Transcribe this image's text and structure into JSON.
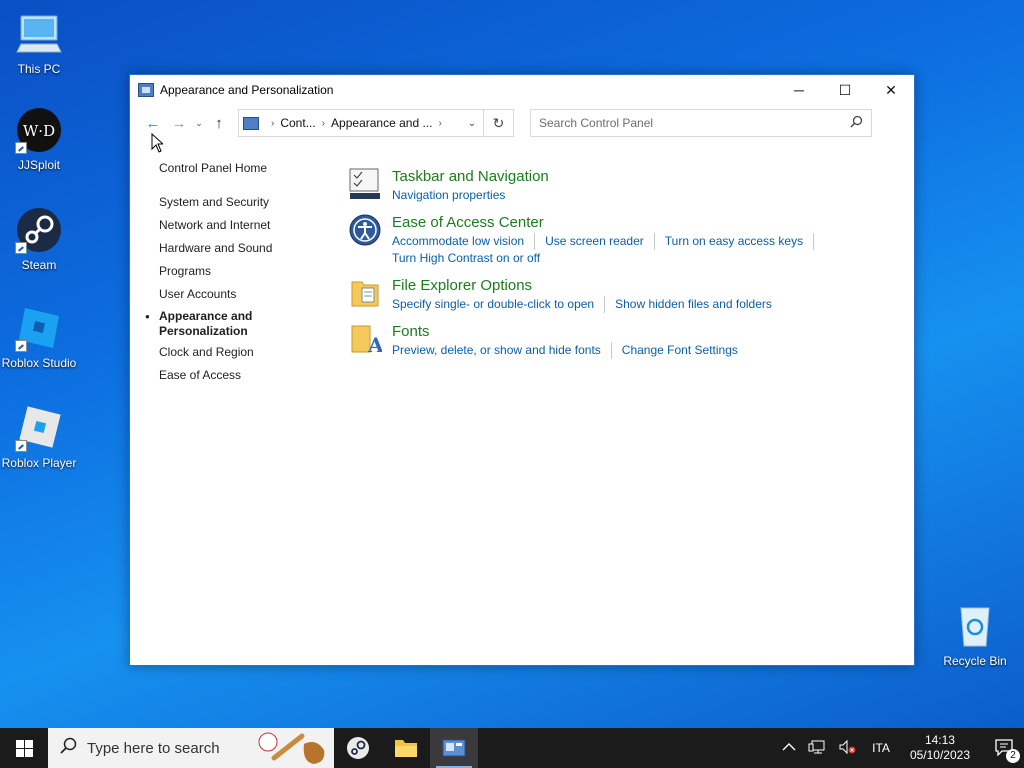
{
  "desktop": {
    "icons": [
      {
        "label": "This PC"
      },
      {
        "label": "JJSploit"
      },
      {
        "label": "Steam"
      },
      {
        "label": "Roblox Studio"
      },
      {
        "label": "Roblox Player"
      },
      {
        "label": "Recycle Bin"
      }
    ]
  },
  "window": {
    "title": "Appearance and Personalization",
    "controls": {
      "minimize": "─",
      "maximize": "☐",
      "close": "✕"
    },
    "nav": {
      "back": "←",
      "forward": "→",
      "recent": "⌄",
      "up": "↑"
    },
    "address": {
      "crumbs": [
        "Cont...",
        "Appearance and ..."
      ],
      "refresh": "↻"
    },
    "search": {
      "placeholder": "Search Control Panel"
    },
    "sidebar": {
      "home": "Control Panel Home",
      "items": [
        "System and Security",
        "Network and Internet",
        "Hardware and Sound",
        "Programs",
        "User Accounts",
        "Appearance and Personalization",
        "Clock and Region",
        "Ease of Access"
      ],
      "active_index": 5
    },
    "categories": [
      {
        "title": "Taskbar and Navigation",
        "icon": "taskbar-icon",
        "links": [
          "Navigation properties"
        ]
      },
      {
        "title": "Ease of Access Center",
        "icon": "ease-of-access-icon",
        "links": [
          "Accommodate low vision",
          "Use screen reader",
          "Turn on easy access keys",
          "Turn High Contrast on or off"
        ]
      },
      {
        "title": "File Explorer Options",
        "icon": "folder-options-icon",
        "links": [
          "Specify single- or double-click to open",
          "Show hidden files and folders"
        ]
      },
      {
        "title": "Fonts",
        "icon": "fonts-icon",
        "links": [
          "Preview, delete, or show and hide fonts",
          "Change Font Settings"
        ]
      }
    ]
  },
  "taskbar": {
    "search_placeholder": "Type here to search",
    "language": "ITA",
    "time": "14:13",
    "date": "05/10/2023",
    "notifications": "2"
  },
  "colors": {
    "category_title": "#1e7b1e",
    "link": "#0b5ea8",
    "taskbar": "#1b1b1c"
  }
}
